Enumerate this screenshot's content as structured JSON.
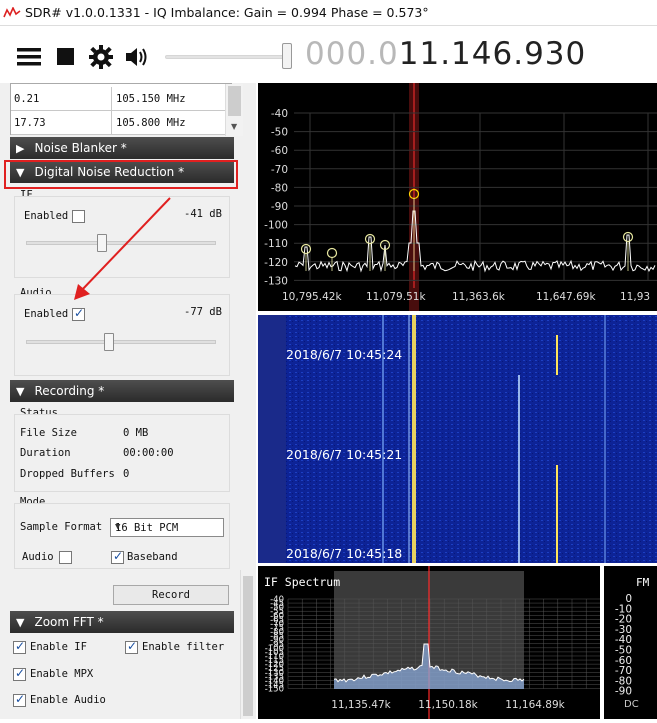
{
  "window": {
    "title": "SDR# v1.0.0.1331 - IQ Imbalance: Gain = 0.994 Phase = 0.573°"
  },
  "toolbar": {
    "icons": [
      "menu-icon",
      "stop-icon",
      "gear-icon",
      "speaker-icon"
    ],
    "frequency_dim": "000.0",
    "frequency_main": "11.146.930"
  },
  "freq_table": {
    "rows": [
      {
        "level": "0.21",
        "freq": "105.150 MHz"
      },
      {
        "level": "17.73",
        "freq": "105.800 MHz"
      }
    ]
  },
  "sections": {
    "noise_blanker": "Noise Blanker *",
    "dnr": "Digital Noise Reduction *",
    "recording": "Recording *",
    "zoom_fft": "Zoom FFT *"
  },
  "dnr": {
    "if_label": "IF",
    "if_enabled_label": "Enabled",
    "if_enabled": false,
    "if_value": "-41 dB",
    "audio_label": "Audio",
    "audio_enabled_label": "Enabled",
    "audio_enabled": true,
    "audio_value": "-77 dB"
  },
  "recording": {
    "status_label": "Status",
    "file_size_label": "File Size",
    "file_size": "0 MB",
    "duration_label": "Duration",
    "duration": "00:00:00",
    "dropped_label": "Dropped Buffers",
    "dropped": "0",
    "mode_label": "Mode",
    "sample_format_label": "Sample Format",
    "sample_format": "16 Bit PCM",
    "audio_label": "Audio",
    "audio_checked": false,
    "baseband_label": "Baseband",
    "baseband_checked": true,
    "record_button": "Record"
  },
  "zoom_fft": {
    "enable_if": "Enable IF",
    "enable_filter": "Enable filter",
    "enable_mpx": "Enable MPX",
    "enable_audio": "Enable Audio"
  },
  "spectrum": {
    "y_ticks": [
      "-40",
      "-50",
      "-60",
      "-70",
      "-80",
      "-90",
      "-100",
      "-110",
      "-120",
      "-130"
    ],
    "x_ticks": [
      "10,795.42k",
      "11,079.51k",
      "11,363.6k",
      "11,647.69k",
      "11,93"
    ]
  },
  "waterfall": {
    "timestamps": [
      "2018/6/7 10:45:24",
      "2018/6/7 10:45:21",
      "2018/6/7 10:45:18"
    ]
  },
  "if_spectrum": {
    "title": "IF Spectrum",
    "y_ticks": [
      "-40",
      "-45",
      "-50",
      "-55",
      "-60",
      "-65",
      "-70",
      "-75",
      "-80",
      "-85",
      "-90",
      "-95",
      "-100",
      "-105",
      "-110",
      "-115",
      "-120",
      "-125",
      "-130",
      "-135",
      "-140",
      "-145",
      "-150"
    ],
    "x_ticks": [
      "11,135.47k",
      "11,150.18k",
      "11,164.89k"
    ]
  },
  "fm_spectrum": {
    "title": "FM",
    "y_ticks": [
      "0",
      "-10",
      "-20",
      "-30",
      "-40",
      "-50",
      "-60",
      "-70",
      "-80",
      "-90"
    ],
    "x_label": "DC"
  },
  "colors": {
    "accent_red": "#e02020",
    "waterfall_bg": "#0a1a6e",
    "trace": "#ffffff",
    "marker": "#ffd700"
  }
}
